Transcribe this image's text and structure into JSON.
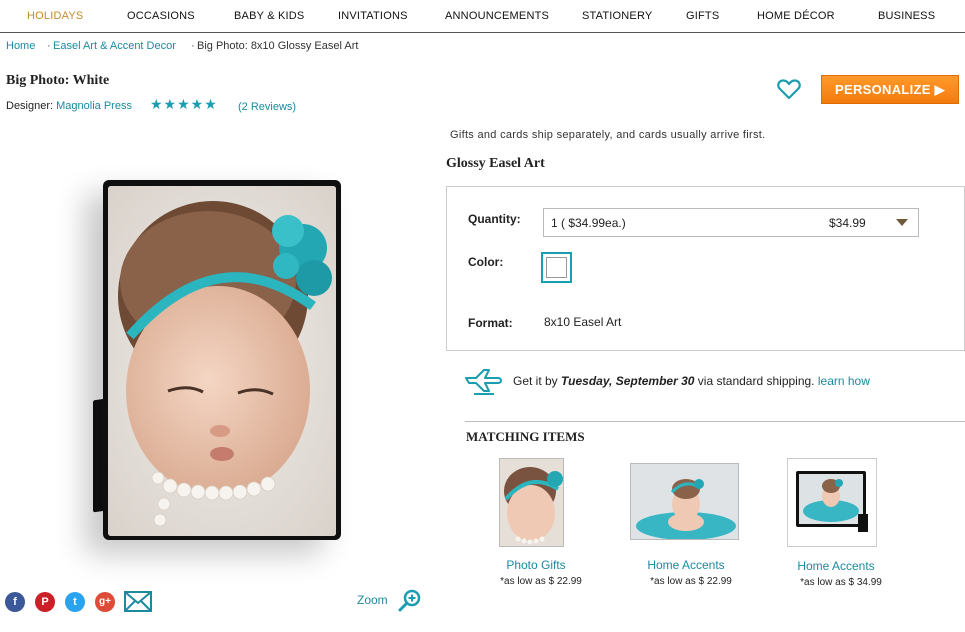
{
  "nav": {
    "items": [
      "HOLIDAYS",
      "OCCASIONS",
      "BABY & KIDS",
      "INVITATIONS",
      "ANNOUNCEMENTS",
      "STATIONERY",
      "GIFTS",
      "HOME DÉCOR",
      "BUSINESS"
    ]
  },
  "breadcrumb": {
    "home": "Home",
    "category": "Easel Art & Accent Decor",
    "current": "Big Photo: 8x10 Glossy Easel Art",
    "sep": "·"
  },
  "product": {
    "title": "Big Photo: White",
    "designer_label": "Designer: ",
    "designer_name": "Magnolia Press",
    "stars": "★★★★★",
    "reviews": "(2 Reviews)"
  },
  "actions": {
    "personalize": "PERSONALIZE ▶"
  },
  "details": {
    "ship_note": "Gifts and cards ship separately, and cards usually arrive first.",
    "product_type": "Glossy Easel Art",
    "quantity_label": "Quantity:",
    "quantity_value": "1 ( $34.99ea.)",
    "quantity_price": "$34.99",
    "color_label": "Color:",
    "format_label": "Format:",
    "format_value": "8x10 Easel Art"
  },
  "shipping": {
    "prefix": "Get it by ",
    "date": "Tuesday, September 30",
    "suffix": " via standard shipping. ",
    "link": "learn how"
  },
  "matching": {
    "title": "MATCHING ITEMS",
    "items": [
      {
        "label": "Photo Gifts",
        "price": "*as low as $ 22.99"
      },
      {
        "label": "Home Accents",
        "price": "*as low as $ 22.99"
      },
      {
        "label": "Home Accents",
        "price": "*as low as $ 34.99"
      }
    ]
  },
  "zoom": {
    "label": "Zoom"
  },
  "social": {
    "facebook": "f",
    "pinterest": "P",
    "twitter": "t",
    "google": "g+"
  },
  "colors": {
    "accent": "#1a9db0",
    "link": "#1a8a9e",
    "cta": "#f47b0e",
    "nav_active": "#c7892c"
  }
}
